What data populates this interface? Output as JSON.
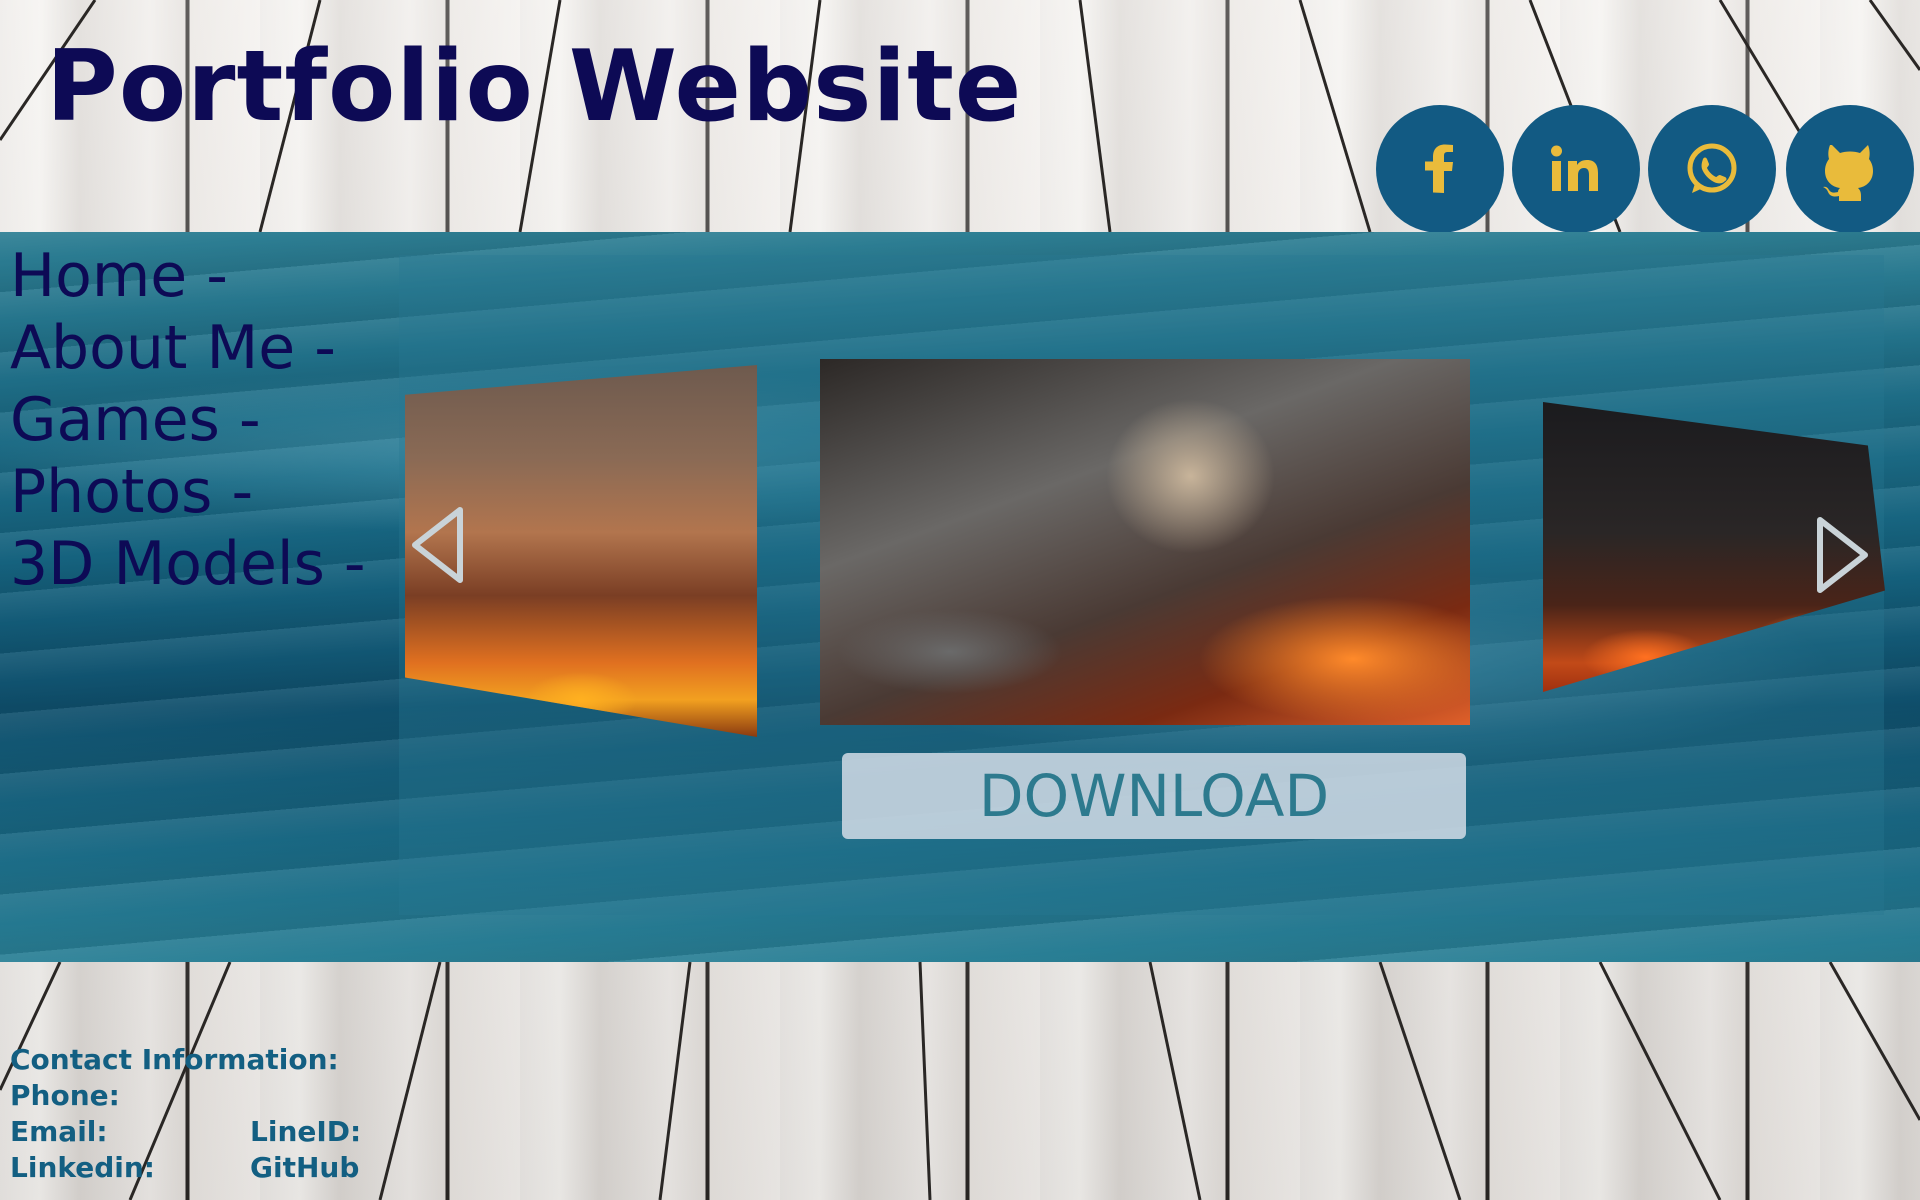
{
  "header": {
    "title": "Portfolio Website"
  },
  "social": [
    {
      "name": "facebook",
      "icon": "facebook-icon"
    },
    {
      "name": "linkedin",
      "icon": "linkedin-icon"
    },
    {
      "name": "whatsapp",
      "icon": "whatsapp-icon"
    },
    {
      "name": "github",
      "icon": "github-icon"
    }
  ],
  "nav": {
    "items": [
      {
        "label": "Home -"
      },
      {
        "label": "About Me -"
      },
      {
        "label": "Games -"
      },
      {
        "label": "Photos -"
      },
      {
        "label": "3D Models -"
      }
    ]
  },
  "slider": {
    "slides": [
      "cat-volcano-artwork",
      "pug-volcano-artwork",
      "cats-fortress-artwork"
    ],
    "download_label": "DOWNLOAD"
  },
  "footer": {
    "contact_heading": "Contact Information:",
    "phone_label": "Phone:",
    "email_label": "Email:",
    "lineid_label": "LineID:",
    "linkedin_label": "Linkedin:",
    "github_label": "GitHub"
  },
  "colors": {
    "title": "#0d0a55",
    "social_bg": "#125a83",
    "icon_gold": "#e9bb3b",
    "footer_text": "#135f82",
    "button_text": "#2d7a8e"
  }
}
